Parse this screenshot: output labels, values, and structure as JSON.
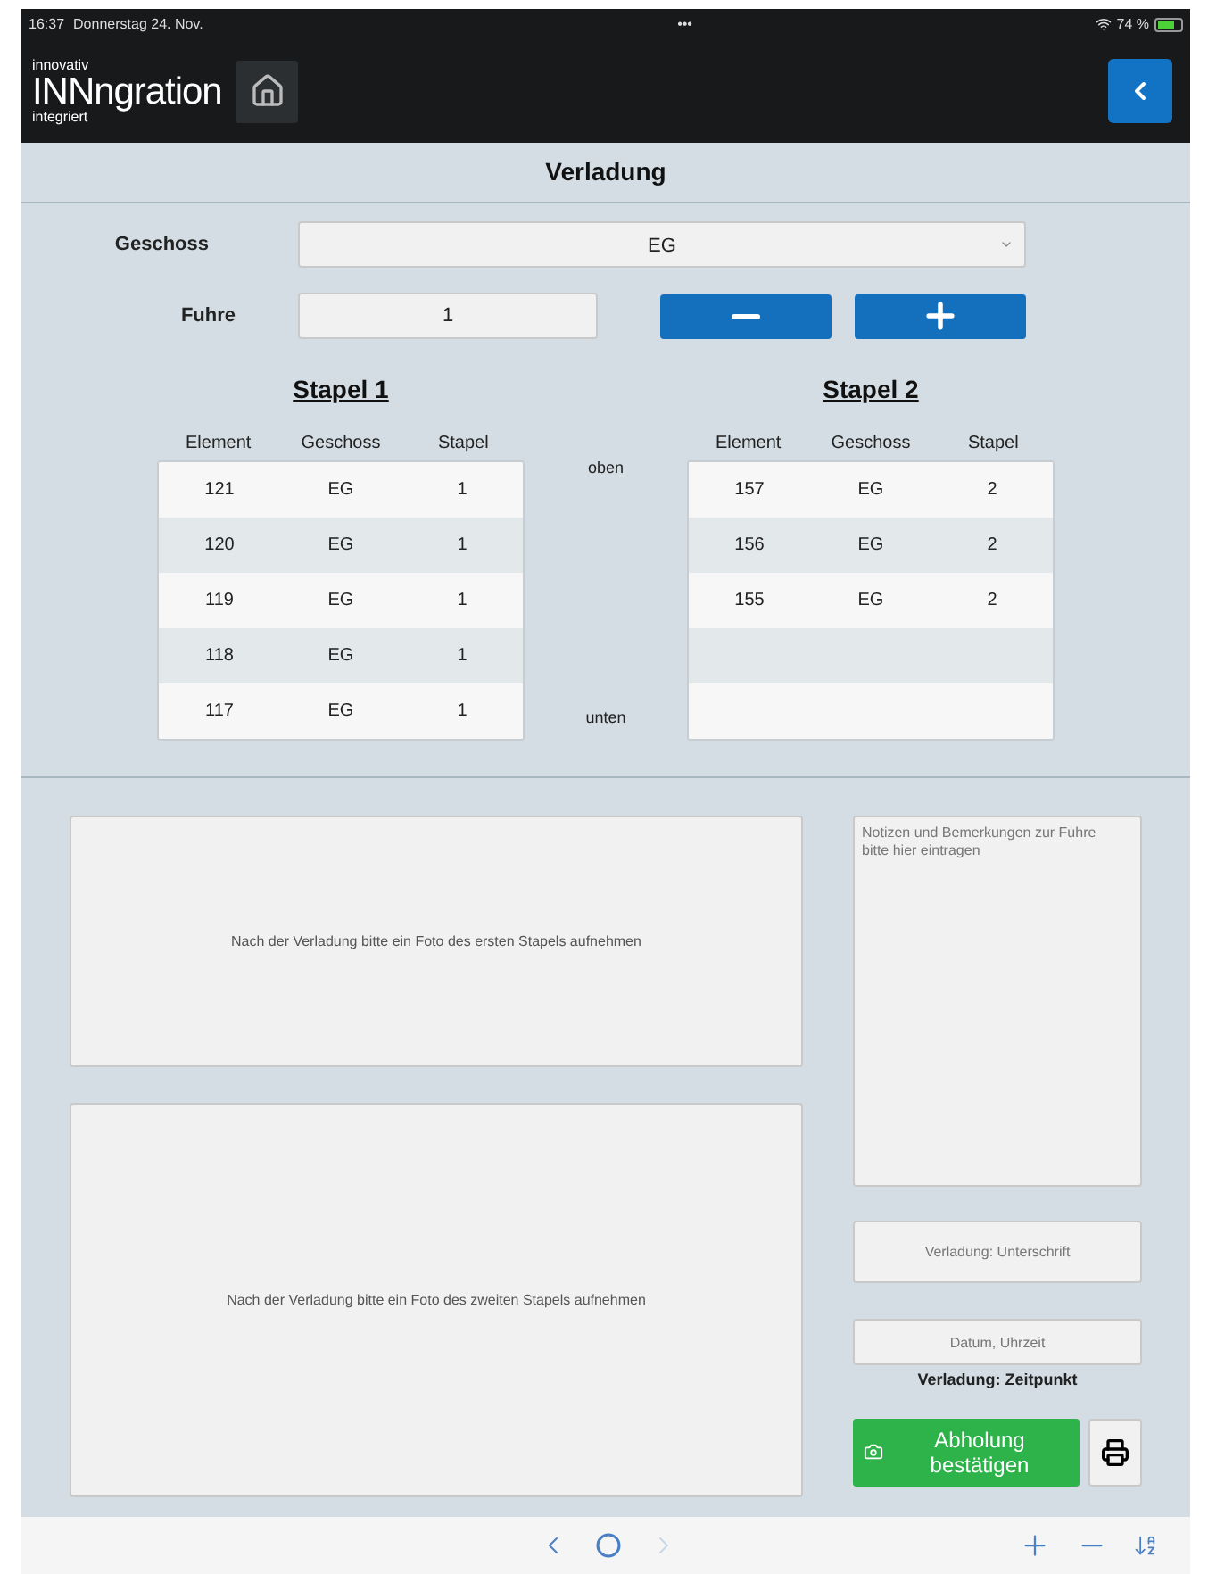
{
  "status_bar": {
    "time": "16:37",
    "date": "Donnerstag 24. Nov.",
    "dots": "•••",
    "battery": "74 %"
  },
  "app_bar": {
    "logo_top": "innovativ",
    "logo_main": "**INNn**gration",
    "logo_bottom": "integriert"
  },
  "title": "Verladung",
  "form": {
    "geschoss_label": "Geschoss",
    "geschoss_value": "EG",
    "fuhre_label": "Fuhre",
    "fuhre_value": "1"
  },
  "stacks": [
    {
      "title": "Stapel 1",
      "columns": [
        "Element",
        "Geschoss",
        "Stapel"
      ],
      "rows": [
        [
          "121",
          "EG",
          "1"
        ],
        [
          "120",
          "EG",
          "1"
        ],
        [
          "119",
          "EG",
          "1"
        ],
        [
          "118",
          "EG",
          "1"
        ],
        [
          "117",
          "EG",
          "1"
        ]
      ]
    },
    {
      "title": "Stapel 2",
      "columns": [
        "Element",
        "Geschoss",
        "Stapel"
      ],
      "rows": [
        [
          "157",
          "EG",
          "2"
        ],
        [
          "156",
          "EG",
          "2"
        ],
        [
          "155",
          "EG",
          "2"
        ]
      ]
    }
  ],
  "order_labels": {
    "top": "oben",
    "bottom": "unten"
  },
  "photos": [
    "Nach der Verladung bitte ein Foto des ersten Stapels aufnehmen",
    "Nach der Verladung bitte ein Foto des zweiten Stapels aufnehmen"
  ],
  "notes": {
    "placeholder": "Notizen und Bemerkungen zur Fuhre\nbitte hier eintragen"
  },
  "signature": {
    "placeholder": "Verladung: Unterschrift"
  },
  "datetime": {
    "placeholder": "Datum, Uhrzeit",
    "label": "Verladung: Zeitpunkt"
  },
  "confirm_button": "Abholung bestätigen",
  "browser_nav": {
    "forward_disabled": true
  }
}
